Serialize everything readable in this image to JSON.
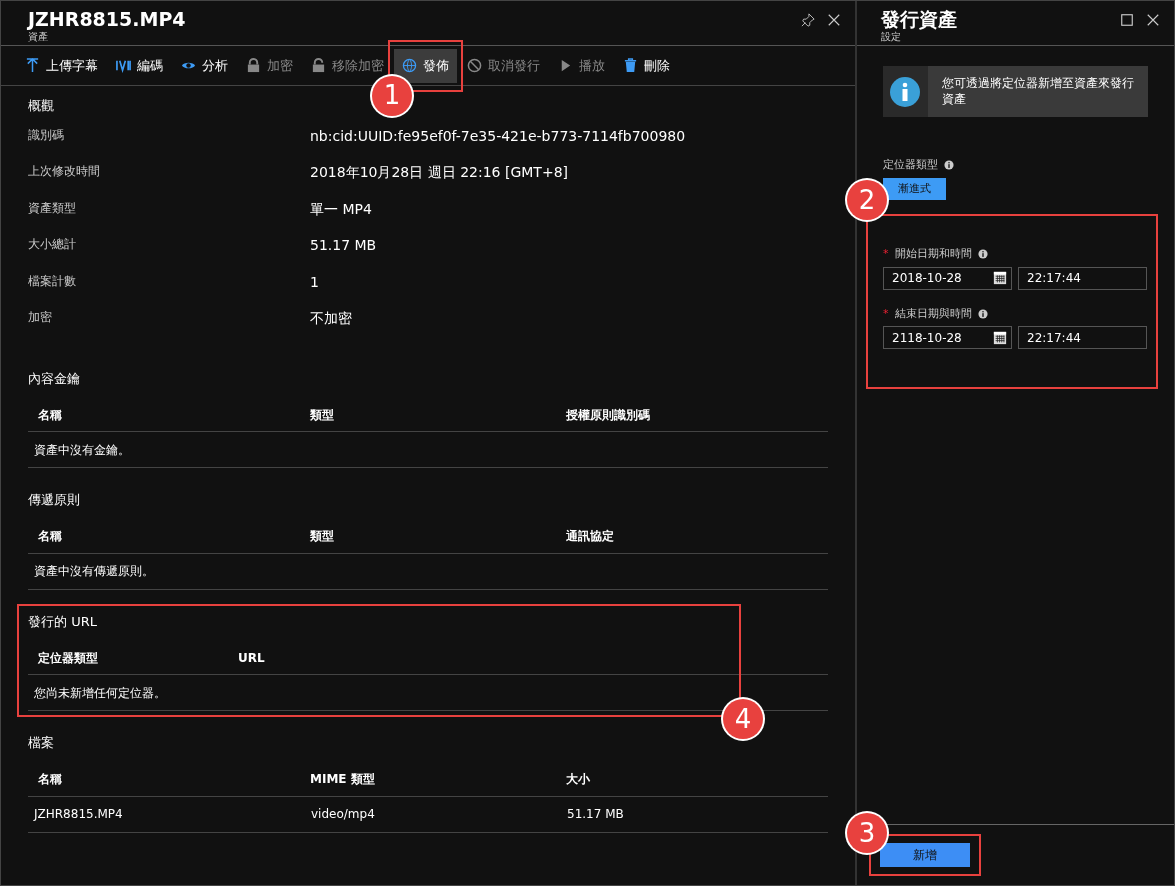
{
  "main_blade": {
    "title": "JZHR8815.MP4",
    "subtitle": "資產",
    "toolbar": [
      {
        "kind": "upload",
        "label": "上傳字幕",
        "disabled": false,
        "selected": false
      },
      {
        "kind": "encode",
        "label": "編碼",
        "disabled": false,
        "selected": false
      },
      {
        "kind": "eye",
        "label": "分析",
        "disabled": false,
        "selected": false
      },
      {
        "kind": "lock",
        "label": "加密",
        "disabled": true,
        "selected": false
      },
      {
        "kind": "unlock",
        "label": "移除加密",
        "disabled": true,
        "selected": false
      },
      {
        "kind": "globe",
        "label": "發佈",
        "disabled": false,
        "selected": true,
        "callout": "1"
      },
      {
        "kind": "ban",
        "label": "取消發行",
        "disabled": true,
        "selected": false
      },
      {
        "kind": "play",
        "label": "播放",
        "disabled": true,
        "selected": false
      },
      {
        "kind": "trash",
        "label": "刪除",
        "disabled": false,
        "selected": false
      }
    ],
    "overview": {
      "heading": "概觀",
      "rows": [
        {
          "label": "識別碼",
          "value": "nb:cid:UUID:fe95ef0f-7e35-421e-b773-7114fb700980"
        },
        {
          "label": "上次修改時間",
          "value": "2018年10月28日 週日 22:16 [GMT+8]"
        },
        {
          "label": "資產類型",
          "value": "單一 MP4"
        },
        {
          "label": "大小總計",
          "value": "51.17 MB"
        },
        {
          "label": "檔案計數",
          "value": "1"
        },
        {
          "label": "加密",
          "value": "不加密"
        }
      ]
    },
    "tables": [
      {
        "heading": "內容金鑰",
        "columns": [
          "名稱",
          "類型",
          "授權原則識別碼"
        ],
        "empty_message": "資產中沒有金鑰。"
      },
      {
        "heading": "傳遞原則",
        "columns": [
          "名稱",
          "類型",
          "通訊協定"
        ],
        "empty_message": "資產中沒有傳遞原則。"
      },
      {
        "heading": "發行的 URL",
        "columns": [
          "定位器類型",
          "URL"
        ],
        "empty_message": "您尚未新增任何定位器。",
        "callout": "4"
      },
      {
        "heading": "檔案",
        "columns": [
          "名稱",
          "MIME 類型",
          "大小"
        ],
        "rows": [
          [
            "JZHR8815.MP4",
            "video/mp4",
            "51.17 MB"
          ]
        ]
      }
    ]
  },
  "side_blade": {
    "title": "發行資產",
    "subtitle": "設定",
    "info": "您可透過將定位器新增至資產來發行資產",
    "locator_type": {
      "label": "定位器類型",
      "value": "漸進式"
    },
    "dates_callout": "2",
    "dates": [
      {
        "label": "開始日期和時間",
        "required_mark": "*",
        "date": "2018-10-28",
        "time": "22:17:44"
      },
      {
        "label": "結束日期與時間",
        "required_mark": "*",
        "date": "2118-10-28",
        "time": "22:17:44"
      }
    ],
    "add_button": {
      "label": "新增",
      "callout": "3"
    }
  }
}
